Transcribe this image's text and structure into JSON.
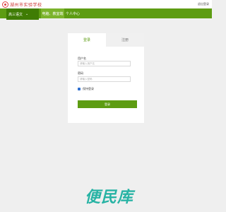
{
  "header": {
    "logo_text": "湖州市实验学校",
    "top_right_link": "退出登录"
  },
  "nav": {
    "select_label": "高三语文",
    "select_chevron": "⌄",
    "tabs": [
      {
        "label": "电脑、教室端",
        "active": true
      },
      {
        "label": "个人中心",
        "active": false
      }
    ]
  },
  "login_card": {
    "tabs": [
      {
        "label": "登录",
        "active": true
      },
      {
        "label": "注册",
        "active": false
      }
    ],
    "username": {
      "label": "用户名",
      "placeholder": "请输入用户名",
      "value": ""
    },
    "password": {
      "label": "密码",
      "placeholder": "请输入密码",
      "value": ""
    },
    "remember": {
      "label": "保持登录",
      "checked": true
    },
    "submit_label": "登录"
  },
  "watermark": "便民库",
  "colors": {
    "nav_green": "#5d9c12",
    "nav_dark_green": "#3f7c04",
    "watermark_teal": "#27b3a4",
    "background": "#efefef"
  }
}
